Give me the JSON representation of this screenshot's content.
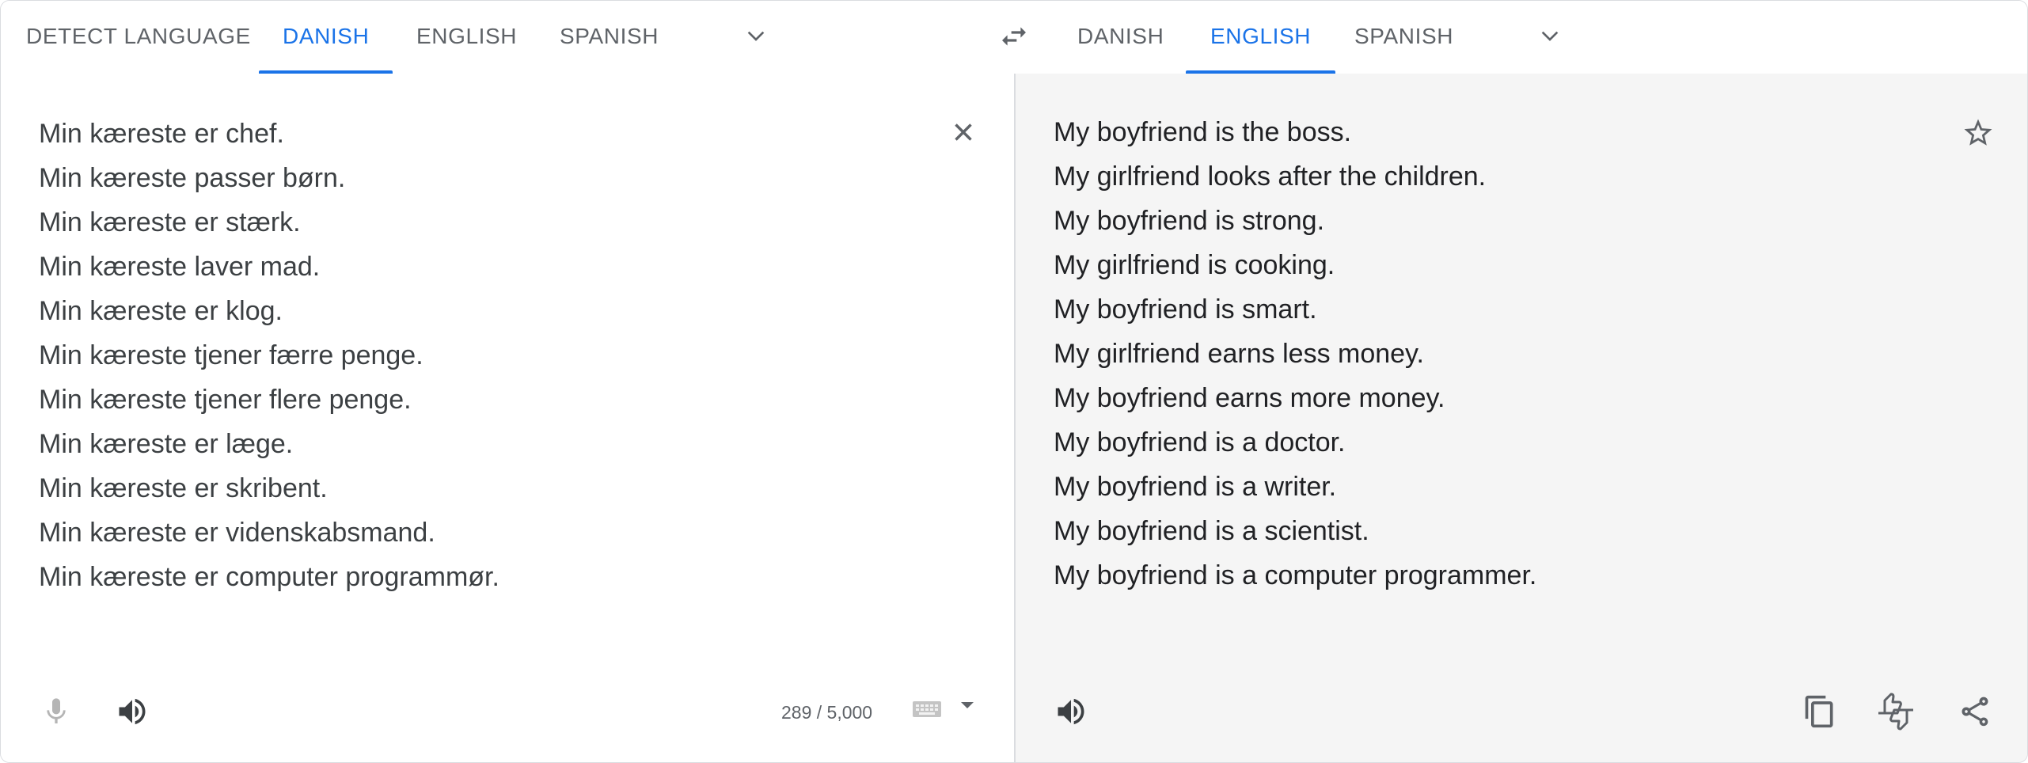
{
  "source_languages": {
    "tabs": [
      {
        "label": "DETECT LANGUAGE"
      },
      {
        "label": "DANISH"
      },
      {
        "label": "ENGLISH"
      },
      {
        "label": "SPANISH"
      }
    ],
    "active": "DANISH",
    "more_icon": "chevron-down-icon"
  },
  "swap_icon": "swap-arrows-icon",
  "target_languages": {
    "tabs": [
      {
        "label": "DANISH"
      },
      {
        "label": "ENGLISH"
      },
      {
        "label": "SPANISH"
      }
    ],
    "active": "ENGLISH",
    "more_icon": "chevron-down-icon"
  },
  "source": {
    "text": "Min kæreste er chef.\nMin kæreste passer børn.\nMin kæreste er stærk.\nMin kæreste laver mad.\nMin kæreste er klog.\nMin kæreste tjener færre penge.\nMin kæreste tjener flere penge.\nMin kæreste er læge.\nMin kæreste er skribent.\nMin kæreste er videnskabsmand.\nMin kæreste er computer programmør.",
    "char_count": "289 / 5,000",
    "icons": [
      "close-icon",
      "microphone-icon",
      "speaker-icon",
      "keyboard-icon",
      "caret-down-icon"
    ]
  },
  "translation": {
    "text": "My boyfriend is the boss.\nMy girlfriend looks after the children.\nMy boyfriend is strong.\nMy girlfriend is cooking.\nMy boyfriend is smart.\nMy girlfriend earns less money.\nMy boyfriend earns more money.\nMy boyfriend is a doctor.\nMy boyfriend is a writer.\nMy boyfriend is a scientist.\nMy boyfriend is a computer programmer.",
    "icons": [
      "star-icon",
      "speaker-icon",
      "copy-icon",
      "feedback-icon",
      "share-icon"
    ]
  },
  "colors": {
    "accent": "#1a73e8",
    "tab_text": "#5f6368",
    "border": "#dadce0",
    "output_bg": "#f5f5f5"
  }
}
